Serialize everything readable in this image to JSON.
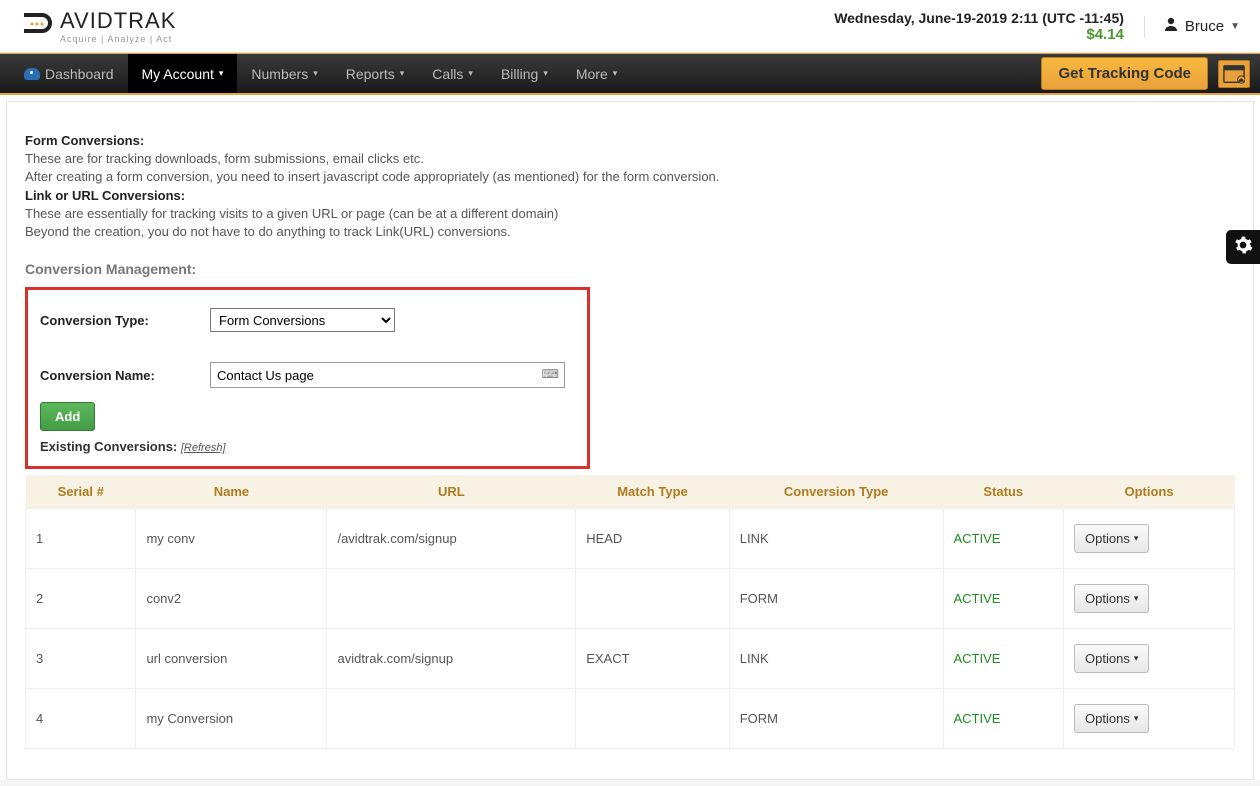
{
  "header": {
    "brand_main": "AVIDTRAK",
    "brand_sub": "Acquire | Analyze | Act",
    "datetime": "Wednesday, June-19-2019 2:11 (UTC -11:45)",
    "balance": "$4.14",
    "user_name": "Bruce"
  },
  "nav": {
    "dashboard": "Dashboard",
    "my_account": "My Account",
    "numbers": "Numbers",
    "reports": "Reports",
    "calls": "Calls",
    "billing": "Billing",
    "more": "More",
    "tracking_button": "Get Tracking Code"
  },
  "intro": {
    "h1": "Form Conversions:",
    "l1": "These are for tracking downloads, form submissions, email clicks etc.",
    "l2": "After creating a form conversion, you need to insert javascript code appropriately (as mentioned) for the form conversion.",
    "h2": "Link or URL Conversions:",
    "l3": "These are essentially for tracking visits to a given URL or page (can be at a different domain)",
    "l4": "Beyond the creation, you do not have to do anything to track Link(URL) conversions.",
    "section": "Conversion Management:"
  },
  "form": {
    "type_label": "Conversion Type:",
    "type_value": "Form Conversions",
    "name_label": "Conversion Name:",
    "name_value": "Contact Us page",
    "add_label": "Add",
    "existing_label": "Existing Conversions:",
    "refresh_label": "[Refresh]"
  },
  "table": {
    "headers": {
      "serial": "Serial #",
      "name": "Name",
      "url": "URL",
      "match": "Match Type",
      "ctype": "Conversion Type",
      "status": "Status",
      "options": "Options"
    },
    "options_btn": "Options",
    "rows": [
      {
        "serial": "1",
        "name": "my conv",
        "url": "/avidtrak.com/signup",
        "match": "HEAD",
        "ctype": "LINK",
        "status": "ACTIVE"
      },
      {
        "serial": "2",
        "name": "conv2",
        "url": "",
        "match": "",
        "ctype": "FORM",
        "status": "ACTIVE"
      },
      {
        "serial": "3",
        "name": "url conversion",
        "url": "avidtrak.com/signup",
        "match": "EXACT",
        "ctype": "LINK",
        "status": "ACTIVE"
      },
      {
        "serial": "4",
        "name": "my Conversion",
        "url": "",
        "match": "",
        "ctype": "FORM",
        "status": "ACTIVE"
      }
    ]
  }
}
